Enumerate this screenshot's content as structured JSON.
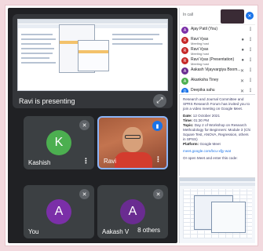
{
  "meet": {
    "presenting_label": "Ravi is presenting",
    "tiles": [
      {
        "name": "Kashish",
        "initial": "K",
        "color": "#4caf50"
      },
      {
        "name": "Ravi"
      },
      {
        "name": "You",
        "initial": "A",
        "color": "#7b2fa8"
      },
      {
        "name": "Aakash V",
        "initial": "A",
        "color": "#6a2c91"
      }
    ],
    "others_chip": "8 others"
  },
  "people_panel": {
    "header_small": "In call",
    "people": [
      {
        "name": "Ajay Patil (You)",
        "initial": "A",
        "color": "#7b2fa8"
      },
      {
        "name": "Ravi Vyas",
        "sub": "Meeting host",
        "initial": "R",
        "color": "#c62828"
      },
      {
        "name": "Ravi Vyas",
        "sub": "Meeting host",
        "initial": "R",
        "color": "#c62828"
      },
      {
        "name": "Ravi Vyas (Presentation)",
        "sub": "Meeting host",
        "initial": "R",
        "color": "#c62828"
      },
      {
        "name": "Aakash Vijayvargiya Boom...",
        "initial": "A",
        "color": "#6a2c91"
      },
      {
        "name": "Akanksha Tiney",
        "initial": "A",
        "color": "#4caf50"
      },
      {
        "name": "Deepika sahu",
        "initial": "D",
        "color": "#1a73e8"
      }
    ]
  },
  "message": {
    "intro": "Research and Journal Committee and SPRS Research Forum has invited you to join a video meeting on Google Meet.",
    "date_label": "Date:",
    "date": "12 October 2021",
    "time_label": "Time:",
    "time": "01:30 PM",
    "topic_label": "Topic:",
    "topic": "Day 2 of Workshop on Research Methodology for Beginners: Module 3 (Chi Square Test, ANOVA, Regression, others in SPSS)",
    "platform_label": "Platform:",
    "platform": "Google Meet",
    "link": "meet.google.com/bcu-xfjy-wat",
    "footer": "Or open Meet and enter this code:"
  }
}
